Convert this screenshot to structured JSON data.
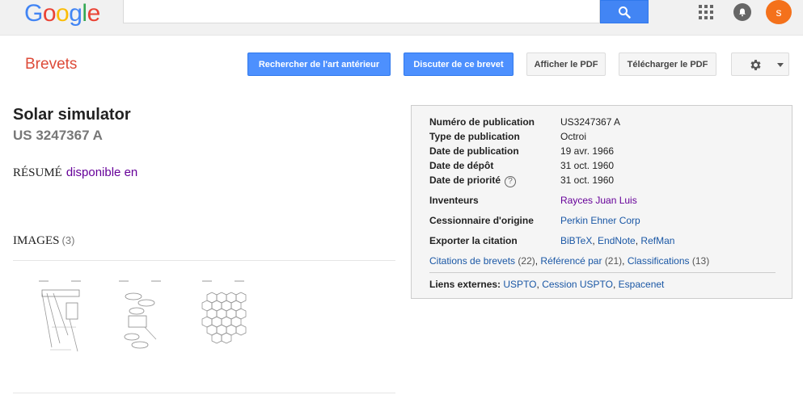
{
  "topbar": {
    "logo": [
      "G",
      "o",
      "o",
      "g",
      "l",
      "e"
    ],
    "avatar_letter": "s",
    "search_value": ""
  },
  "header": {
    "brand": "Brevets",
    "buttons": {
      "prior_art": "Rechercher de l'art antérieur",
      "discuss": "Discuter de ce brevet",
      "view_pdf": "Afficher le PDF",
      "download_pdf": "Télécharger le PDF"
    }
  },
  "patent": {
    "title": "Solar simulator",
    "number": "US 3247367 A",
    "abstract_label": "RÉSUMÉ",
    "abstract_link": "disponible en",
    "images_label": "IMAGES",
    "images_count": "(3)"
  },
  "meta": {
    "rows": [
      {
        "key": "Numéro de publication",
        "value": "US3247367 A"
      },
      {
        "key": "Type de publication",
        "value": "Octroi"
      },
      {
        "key": "Date de publication",
        "value": "19 avr. 1966"
      },
      {
        "key": "Date de dépôt",
        "value": "31 oct. 1960"
      },
      {
        "key": "Date de priorité",
        "value": "31 oct. 1960"
      }
    ],
    "inventors_label": "Inventeurs",
    "inventors_value": "Rayces Juan Luis",
    "assignee_label": "Cessionnaire d'origine",
    "assignee_value": "Perkin Ehner Corp",
    "export_label": "Exporter la citation",
    "export_links": [
      "BiBTeX",
      "EndNote",
      "RefMan"
    ],
    "citations_text": "Citations de brevets",
    "citations_count": "(22)",
    "referenced_text": "Référencé par",
    "referenced_count": "(21)",
    "classifications_text": "Classifications",
    "classifications_count": "(13)",
    "external_label": "Liens externes:",
    "external_links": [
      "USPTO",
      "Cession USPTO",
      "Espacenet"
    ]
  },
  "colors": {
    "brand": "#dd4b39",
    "primary_button": "#4d90fe",
    "avatar": "#f4711b",
    "link_blue": "#1a57a5",
    "visited_purple": "#660099"
  }
}
